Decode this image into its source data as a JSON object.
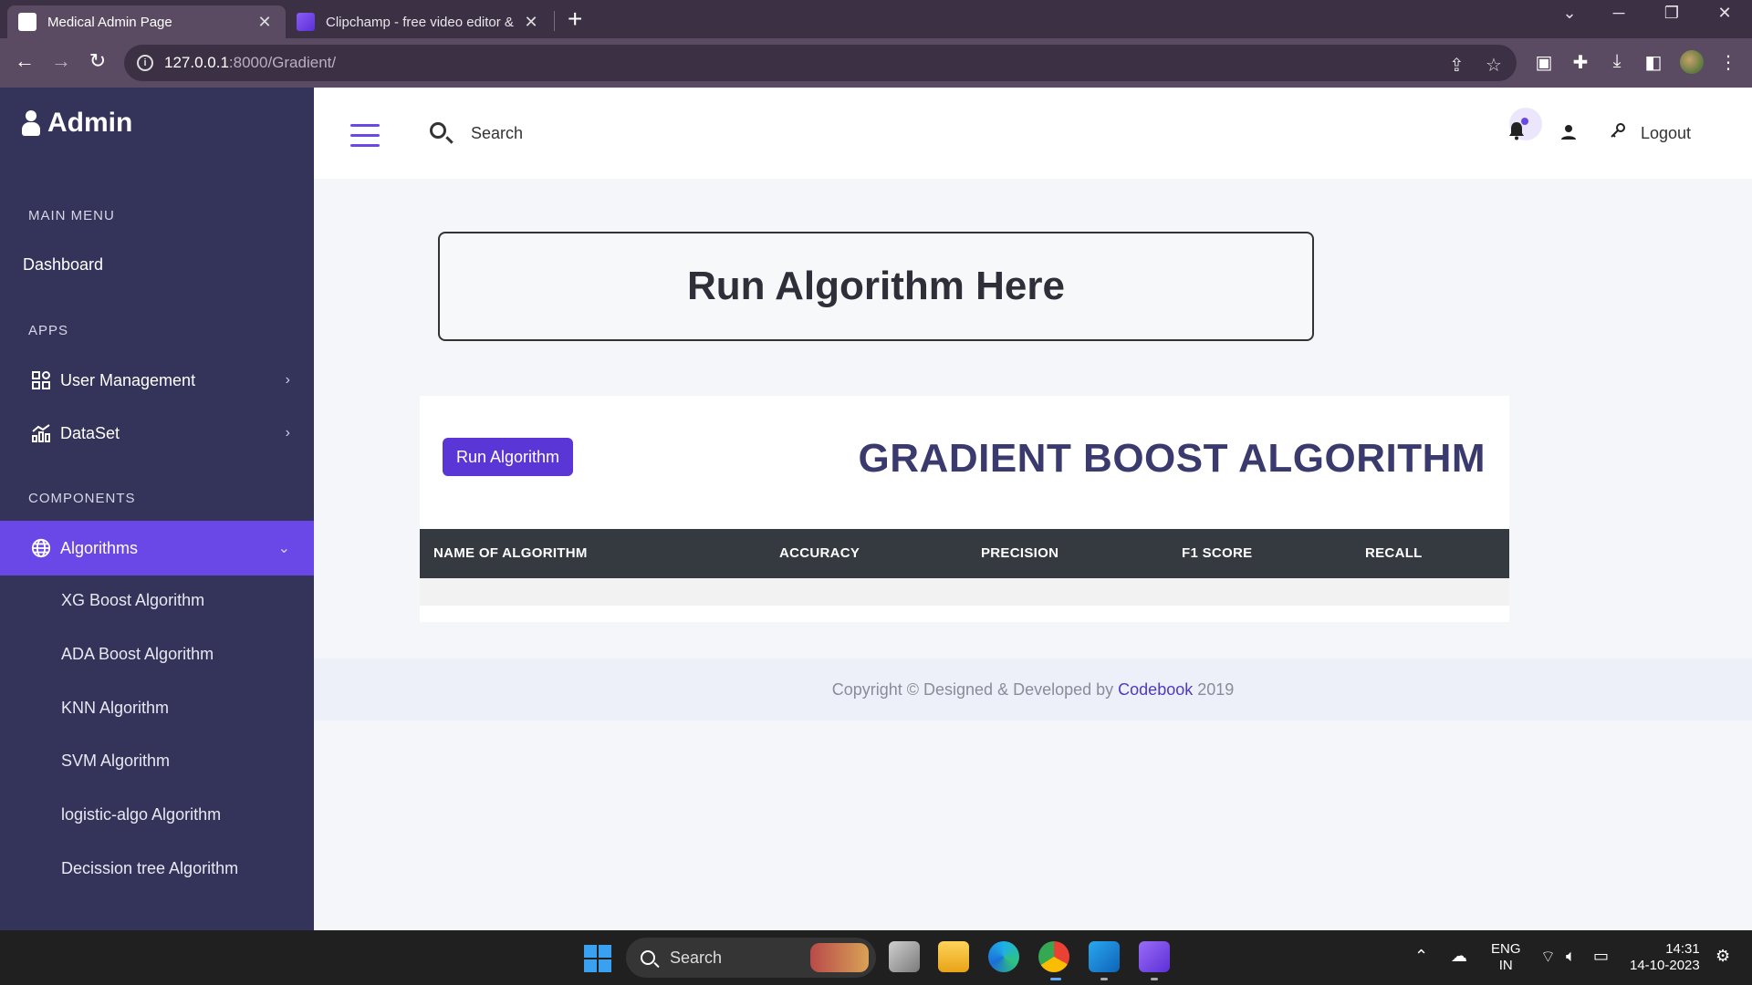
{
  "browser": {
    "tabs": [
      {
        "title": "Medical Admin Page",
        "active": true
      },
      {
        "title": "Clipchamp - free video editor &",
        "active": false
      }
    ],
    "url_host": "127.0.0.1",
    "url_path": ":8000/Gradient/"
  },
  "sidebar": {
    "brand": "Admin",
    "main_menu_heading": "MAIN MENU",
    "dashboard": "Dashboard",
    "apps_heading": "APPS",
    "apps": [
      {
        "label": "User Management",
        "icon": "grid-icon"
      },
      {
        "label": "DataSet",
        "icon": "chart-icon"
      }
    ],
    "components_heading": "COMPONENTS",
    "algorithms_label": "Algorithms",
    "algorithms": [
      "XG Boost Algorithm",
      "ADA Boost Algorithm",
      "KNN Algorithm",
      "SVM Algorithm",
      "logistic-algo Algorithm",
      "Decission tree Algorithm"
    ]
  },
  "topbar": {
    "search_label": "Search",
    "logout_label": "Logout"
  },
  "main": {
    "banner_title": "Run Algorithm Here",
    "run_button": "Run Algorithm",
    "algorithm_title": "GRADIENT BOOST ALGORITHM",
    "table_headers": [
      "NAME OF ALGORITHM",
      "ACCURACY",
      "PRECISION",
      "F1 SCORE",
      "RECALL"
    ]
  },
  "footer": {
    "text_before": "Copyright © Designed & Developed by ",
    "link": "Codebook",
    "text_after": " 2019"
  },
  "taskbar": {
    "search_label": "Search",
    "lang_top": "ENG",
    "lang_bottom": "IN",
    "time": "14:31",
    "date": "14-10-2023"
  },
  "colors": {
    "sidebar_bg": "#34345a",
    "accent": "#6a48e8",
    "button": "#5b36d6",
    "table_header_bg": "#343a40"
  }
}
